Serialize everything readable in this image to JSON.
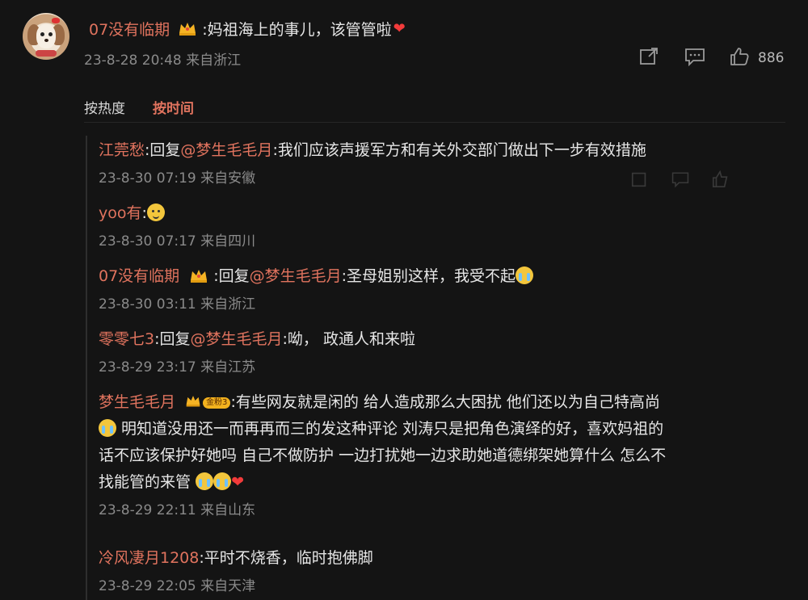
{
  "main_comment": {
    "user": "07没有临期",
    "text": ":妈祖海上的事儿，该管管啦",
    "heart": "❤",
    "time": "23-8-28 20:48",
    "location": "来自浙江",
    "like_count": "886"
  },
  "tabs": [
    {
      "label": "按热度",
      "active": false
    },
    {
      "label": "按时间",
      "active": true
    }
  ],
  "replies": [
    {
      "user": "江莞愁",
      "text": ":回复",
      "mention": "@梦生毛毛月",
      "rest": ":我们应该声援军方和有关外交部门做出下一步有效措施",
      "time": "23-8-30 07:19",
      "location": "来自安徽"
    },
    {
      "user": "yoo有",
      "text": ":",
      "time": "23-8-30 07:17",
      "location": "来自四川"
    },
    {
      "user": "07没有临期",
      "text": ":回复",
      "mention": "@梦生毛毛月",
      "rest": ":圣母姐别这样，我受不起",
      "time": "23-8-30 03:11",
      "location": "来自浙江"
    },
    {
      "user": "零零七3",
      "text": ":回复",
      "mention": "@梦生毛毛月",
      "rest": ":呦，  政通人和来啦",
      "time": "23-8-29 23:17",
      "location": "来自江苏"
    },
    {
      "user": "梦生毛毛月",
      "badge": "金粉3",
      "line1": ":有些网友就是闲的 给人造成那么大困扰 他们还以为自己特高尚",
      "line2": " 明知道没用还一而再再而三的发这种评论 刘涛只是把角色演绎的好，喜欢妈祖的",
      "line3": "话不应该保护好她吗 自己不做防护 一边打扰她一边求助她道德绑架她算什么 怎么不",
      "line4": "找能管的来管",
      "time": "23-8-29 22:11",
      "location": "来自山东"
    },
    {
      "user": "冷风凄月1208",
      "text": ":平时不烧香，临时抱佛脚",
      "time": "23-8-29 22:05",
      "location": "来自天津"
    }
  ],
  "icons": [
    "share-icon",
    "comment-icon",
    "like-icon",
    "crown-icon",
    "heart-icon"
  ],
  "colors": {
    "background": "#141414",
    "username": "#e0735e",
    "meta": "#8a8a8a",
    "text": "#e6e6e6"
  }
}
